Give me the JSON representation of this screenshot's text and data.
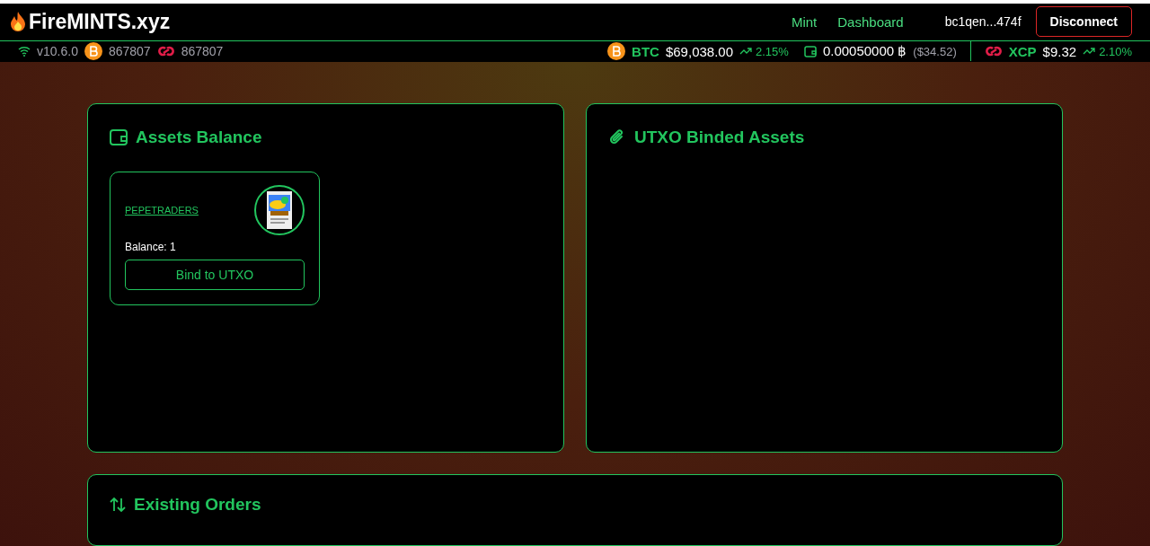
{
  "header": {
    "brand": "FireMINTS.xyz",
    "nav": [
      {
        "label": "Mint"
      },
      {
        "label": "Dashboard"
      }
    ],
    "address": "bc1qen...474f",
    "disconnect": "Disconnect"
  },
  "ticker": {
    "version": "v10.6.0",
    "btc_block": "867807",
    "xcp_block": "867807",
    "btc": {
      "symbol": "BTC",
      "price": "$69,038.00",
      "change": "2.15%"
    },
    "wallet": {
      "amount": "0.00050000 ฿",
      "usd": "($34.52)"
    },
    "xcp": {
      "symbol": "XCP",
      "price": "$9.32",
      "change": "2.10%"
    }
  },
  "assets": {
    "title": "Assets Balance",
    "items": [
      {
        "name": "PEPETRADERS",
        "balance": "Balance: 1",
        "action": "Bind to UTXO"
      }
    ]
  },
  "utxo": {
    "title": "UTXO Binded Assets"
  },
  "orders": {
    "title": "Existing Orders"
  }
}
